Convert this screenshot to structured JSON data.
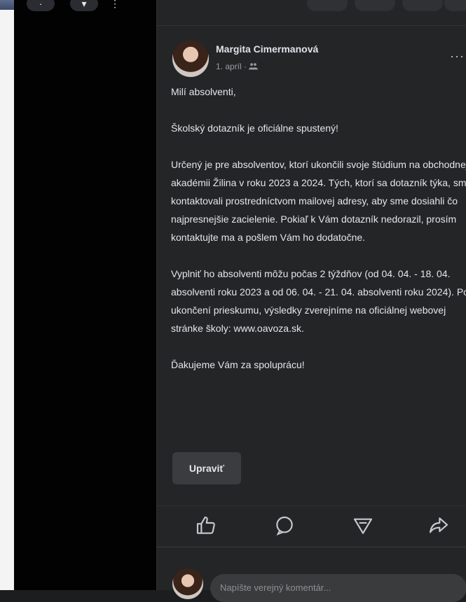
{
  "post": {
    "author": "Margita Cimermanová",
    "date": "1. apríl ·",
    "paragraphs": [
      "Milí absolventi,",
      "Školský dotazník je oficiálne spustený!",
      "Určený je pre absolventov, ktorí ukončili svoje štúdium na obchodnej akadémii Žilina v roku 2023 a 2024. Tých, ktorí sa dotazník týka, sme kontaktovali prostredníctvom mailovej adresy, aby sme dosiahli čo najpresnejšie zacielenie. Pokiaľ k Vám dotazník nedorazil, prosím kontaktujte ma a pošlem Vám ho dodatočne.",
      "Vyplniť ho absolventi môžu počas 2 týždňov (od 04. 04. - 18. 04. absolventi roku 2023 a od 06. 04. - 21. 04. absolventi roku 2024). Po ukončení prieskumu, výsledky zverejníme na oficiálnej webovej stránke školy: www.oavoza.sk.",
      "Ďakujeme Vám za spoluprácu!"
    ],
    "edit_label": "Upraviť"
  },
  "comment": {
    "placeholder": "Napíšte verejný komentár..."
  },
  "icons": {
    "like": "thumbs-up-icon",
    "comment": "comment-icon",
    "send": "send-icon",
    "share": "share-icon",
    "more": "more-icon"
  }
}
